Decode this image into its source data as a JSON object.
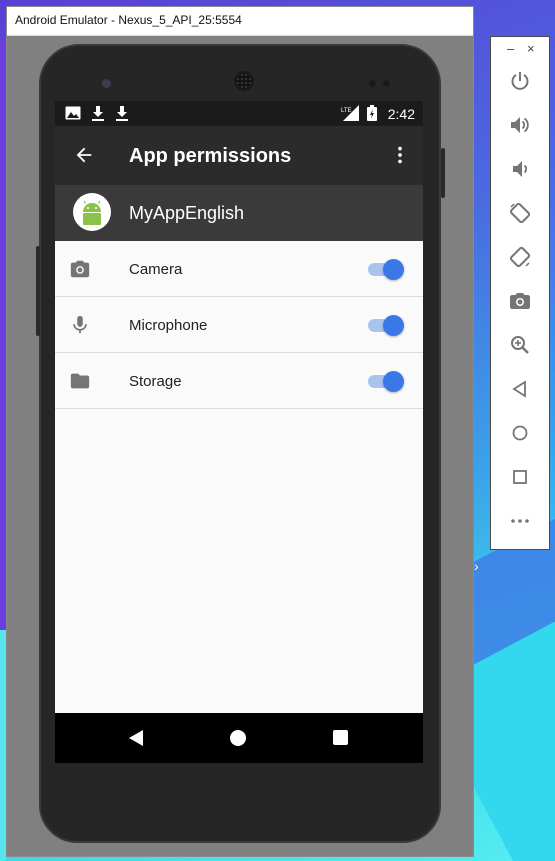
{
  "window": {
    "title": "Android Emulator - Nexus_5_API_25:5554"
  },
  "statusbar": {
    "time": "2:42",
    "icons": [
      "photo-notification-icon",
      "download-icon",
      "download-icon",
      "lte-signal-icon",
      "battery-icon"
    ]
  },
  "toolbar": {
    "title": "App permissions",
    "back_icon": "arrow-back-icon",
    "more_icon": "more-vert-icon"
  },
  "app": {
    "name": "MyAppEnglish",
    "icon": "android-robot-icon",
    "icon_color": "#8bc34a"
  },
  "permissions": [
    {
      "label": "Camera",
      "icon": "camera-icon",
      "enabled": true
    },
    {
      "label": "Microphone",
      "icon": "microphone-icon",
      "enabled": true
    },
    {
      "label": "Storage",
      "icon": "folder-icon",
      "enabled": true
    }
  ],
  "colors": {
    "accent": "#3b78e7",
    "toolbar": "#2b2b2b",
    "app_header": "#3a3a3a"
  },
  "controls": {
    "minimize": "–",
    "close": "×",
    "buttons": [
      "power-icon",
      "volume-up-icon",
      "volume-down-icon",
      "rotate-left-icon",
      "rotate-right-icon",
      "screenshot-icon",
      "zoom-icon",
      "back-icon",
      "home-icon",
      "overview-icon",
      "more-icon"
    ]
  }
}
